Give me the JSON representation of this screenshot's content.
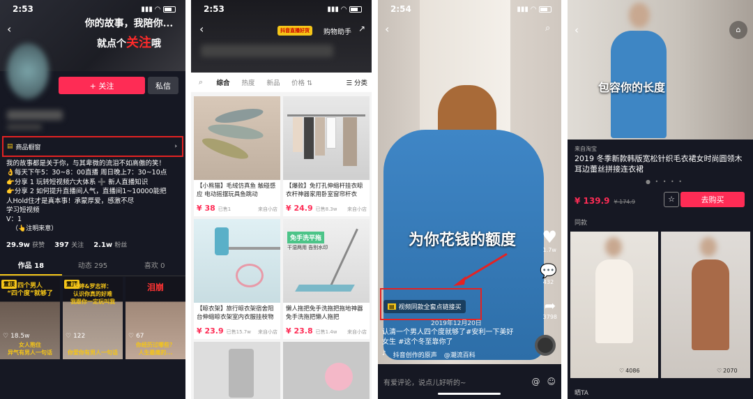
{
  "status": {
    "p1_time": "2:53",
    "p2_time": "2:53",
    "p3_time": "2:54"
  },
  "profile": {
    "banner_line1": "你的故事，我陪你...",
    "banner_line2": "就点个",
    "banner_highlight": "关注",
    "banner_tail": "哦",
    "follow_label": "+ 关注",
    "message_label": "私信",
    "showcase_label": "商品橱窗",
    "bio": [
      "我的故事都是关于你，与其卑微的流泪不如高傲的笑！",
      "👌每天下午5：30~8：00直播 周日晚上7：30~10点",
      "👉分享 1 玩转短视频六大体系 ➕ 新人直播知识",
      "👉分享 2 如何提升直播间人气，直播间1~10000能把",
      "人Hold住才是真本事！承蒙厚爱，感激不尽",
      "学习短视频",
      "V：1"
    ],
    "note": "（👆注明来意）",
    "stats": [
      {
        "num": "29.9w",
        "label": "获赞"
      },
      {
        "num": "397",
        "label": "关注"
      },
      {
        "num": "2.1w",
        "label": "粉丝"
      }
    ],
    "tabs": [
      "作品 18",
      "动态 295",
      "喜欢 0"
    ],
    "videos": [
      {
        "tag": "置顶",
        "title": "四个男人\n“四个度”就够了",
        "likes": "18.5w",
        "caption": "女人抱住\n异气有男人一句话"
      },
      {
        "tag": "置顶",
        "title": "杨婷&罗志祥：\n认识你真的好难\n我跟你一定玩叫我",
        "likes": "122",
        "caption": "你爱你有男人一句话"
      },
      {
        "tag": "",
        "title": "泪崩",
        "likes": "67",
        "caption": "你经历过哪些？\n人生最痛的..."
      }
    ]
  },
  "shop": {
    "badge": "抖音直播好货",
    "assistant": "购物助手",
    "filters": [
      "综合",
      "热度",
      "新品",
      "价格",
      "分类"
    ],
    "products": [
      {
        "title": "【小熊猫】毛绒仿真鱼 触碰感应 电动摇摆玩具鱼跳动",
        "price": "¥ 38",
        "sold": "已售1",
        "src": "来自小店"
      },
      {
        "title": "【爆款】免打孔伸缩杆挂衣晾衣杆神器家用卧室窗帘杆衣",
        "price": "¥ 24.9",
        "sold": "已售8.3w",
        "src": "来自小店"
      },
      {
        "title": "【晾衣架】旅行晾衣架宿舍阳台伸缩晾衣架室内衣服挂枝物",
        "price": "¥ 23.9",
        "sold": "已售15.7w",
        "src": "来自小店"
      },
      {
        "title": "懒人拖把免手洗拖把拖地神器免手洗拖把懒人拖把",
        "price": "¥ 23.8",
        "sold": "已售1.4w",
        "src": "来自小店"
      }
    ],
    "mop_caption": "免手洗平拖",
    "mop_sub": "干湿两用 告别水印"
  },
  "video": {
    "overlay": "为你花钱的额度",
    "shop_link": "视频同款全套点链接买",
    "date": "2019年12月20日",
    "caption": "认清一个男人四个度就够了#安利一下美好女生 #这个冬至靠你了",
    "music": "抖音创作的原声",
    "music2": "@潮流百科",
    "likes": "1.7w",
    "comments": "432",
    "shares": "3798",
    "comment_placeholder": "有爱评论，说点儿好听的~"
  },
  "product_page": {
    "overlay": "包容你的长度",
    "source": "来自淘宝",
    "title": "2019 冬季新款韩版宽松针织毛衣裙女时尚圆领木耳边蕾丝拼接连衣裙",
    "price": "¥ 139.9",
    "old_price": "¥ 174.9",
    "buy_label": "去购买",
    "similar_label": "同款",
    "similar": [
      {
        "likes": "4086"
      },
      {
        "likes": "2070"
      }
    ],
    "bottom_label": "晒TA"
  },
  "colors": {
    "accent": "#fe2c55",
    "highlight": "#e52222",
    "tiktok_bg": "#161823"
  }
}
